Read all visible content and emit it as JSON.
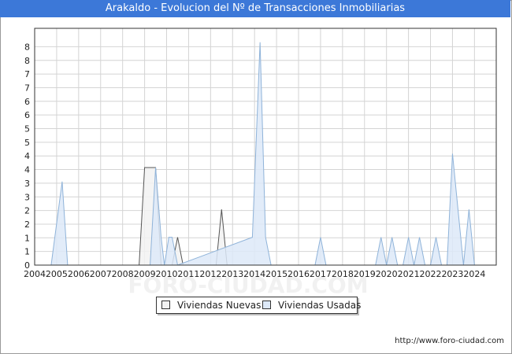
{
  "title": "Arakaldo - Evolucion del Nº de Transacciones Inmobiliarias",
  "footer_url": "http://www.foro-ciudad.com",
  "watermark": "FORO-CIUDAD.COM",
  "colors": {
    "title_bg": "#3c78d8",
    "nuevas_fill": "#f2f2f2",
    "nuevas_line": "#555555",
    "usadas_fill": "#dde9f8",
    "usadas_line": "#8fb3d9",
    "grid": "#d4d4d4"
  },
  "chart_data": {
    "type": "area",
    "title": "Arakaldo - Evolucion del Nº de Transacciones Inmobiliarias",
    "xlabel": "",
    "ylabel": "",
    "x_ticks": [
      "2004",
      "2005",
      "2006",
      "2007",
      "2008",
      "2009",
      "2010",
      "2011",
      "2012",
      "2013",
      "2014",
      "2015",
      "2016",
      "2017",
      "2018",
      "2019",
      "2020",
      "2021",
      "2022",
      "2023",
      "2024"
    ],
    "y_ticks": [
      "0",
      "1",
      "1",
      "2",
      "2",
      "3",
      "3",
      "4",
      "4",
      "5",
      "5",
      "6",
      "6",
      "7",
      "7",
      "8",
      "8"
    ],
    "xlim": [
      2004,
      2024.99
    ],
    "ylim": [
      0,
      8.5
    ],
    "grid": true,
    "legend_position": "bottom",
    "series": [
      {
        "name": "Viviendas Nuevas",
        "x": [
          2008.75,
          2009.0,
          2009.5,
          2009.75,
          2010.25,
          2010.5,
          2010.75,
          2011.0,
          2012.25,
          2012.5,
          2012.75,
          2013.0
        ],
        "y": [
          0,
          3.5,
          3.5,
          0,
          0,
          1,
          0,
          0,
          0,
          2,
          0,
          0
        ]
      },
      {
        "name": "Viviendas Usadas",
        "x": [
          2004.75,
          2005.25,
          2005.5,
          2009.25,
          2009.5,
          2009.75,
          2009.9,
          2010.1,
          2010.25,
          2010.5,
          2013.9,
          2014.25,
          2014.5,
          2014.75,
          2016.75,
          2017.0,
          2017.25,
          2019.5,
          2019.75,
          2020.0,
          2020.25,
          2020.5,
          2020.75,
          2021.0,
          2021.25,
          2021.5,
          2021.75,
          2022.0,
          2022.25,
          2022.5,
          2022.75,
          2023.0,
          2023.25,
          2023.5,
          2023.75,
          2024.0
        ],
        "y": [
          0,
          3,
          0,
          0,
          3.5,
          1,
          0,
          1,
          1,
          0,
          1,
          8,
          1,
          0,
          0,
          1,
          0,
          0,
          1,
          0,
          1,
          0,
          0,
          1,
          0,
          1,
          0,
          0,
          1,
          0,
          0,
          4,
          2,
          0,
          2,
          0
        ]
      }
    ]
  }
}
